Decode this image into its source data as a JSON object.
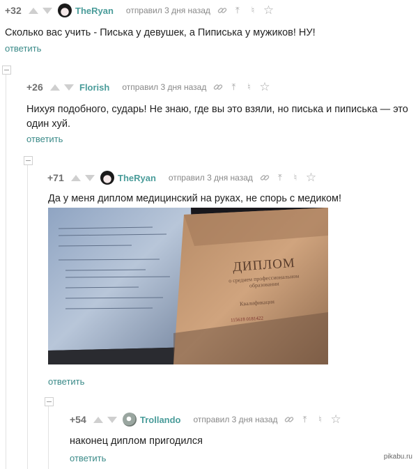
{
  "icons": {
    "upvote": "arrow-up",
    "downvote": "arrow-down",
    "link": "chain-link",
    "pin": "pin",
    "bookmark": "save",
    "star": "star"
  },
  "comments": [
    {
      "rating": "+32",
      "author": "TheRyan",
      "meta": "отправил 3 дня назад",
      "text": "Сколько вас учить - Писька у девушек, а Пиписька у мужиков! НУ!",
      "reply": "ответить"
    },
    {
      "rating": "+26",
      "author": "Florish",
      "meta": "отправил 3 дня назад",
      "text": "Нихуя подобного, сударь! Не знаю, где вы это взяли, но писька и пиписька — это один хуй.",
      "reply": "ответить"
    },
    {
      "rating": "+71",
      "author": "TheRyan",
      "meta": "отправил 3 дня назад",
      "text": "Да у меня диплом медицинский на руках, не спорь с медиком!",
      "reply": "ответить",
      "photo": {
        "diploma_title": "ДИПЛОМ",
        "diploma_subtitle": "о среднем профессиональном образовании",
        "qualification": "Квалификация",
        "number": "115618 0181422"
      }
    },
    {
      "rating": "+54",
      "author": "Trollando",
      "meta": "отправил 3 дня назад",
      "text": "наконец диплом пригодился",
      "reply": "ответить"
    }
  ],
  "watermark": "pikabu.ru"
}
